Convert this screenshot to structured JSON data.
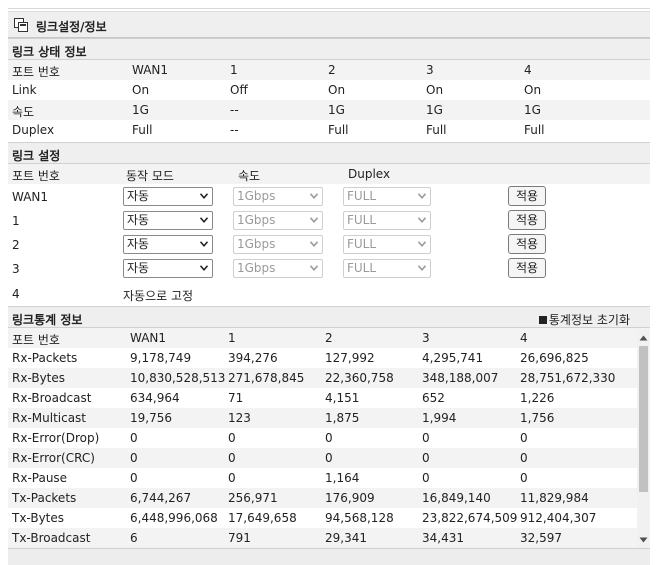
{
  "title": "링크설정/정보",
  "status": {
    "heading": "링크 상태 정보",
    "columns": [
      "포트 번호",
      "WAN1",
      "1",
      "2",
      "3",
      "4"
    ],
    "rows": [
      [
        "Link",
        "On",
        "Off",
        "On",
        "On",
        "On"
      ],
      [
        "속도",
        "1G",
        "--",
        "1G",
        "1G",
        "1G"
      ],
      [
        "Duplex",
        "Full",
        "--",
        "Full",
        "Full",
        "Full"
      ]
    ]
  },
  "config": {
    "heading": "링크 설정",
    "columns": [
      "포트 번호",
      "동작 모드",
      "속도",
      "Duplex"
    ],
    "rows": [
      {
        "port": "WAN1",
        "mode": "자동",
        "speed": "1Gbps",
        "duplex": "FULL",
        "apply": "적용"
      },
      {
        "port": "1",
        "mode": "자동",
        "speed": "1Gbps",
        "duplex": "FULL",
        "apply": "적용"
      },
      {
        "port": "2",
        "mode": "자동",
        "speed": "1Gbps",
        "duplex": "FULL",
        "apply": "적용"
      },
      {
        "port": "3",
        "mode": "자동",
        "speed": "1Gbps",
        "duplex": "FULL",
        "apply": "적용"
      }
    ],
    "fixed_port": "4",
    "fixed_text": "자동으로 고정"
  },
  "stats": {
    "heading": "링크통계 정보",
    "reset_label": "통계정보 초기화",
    "columns": [
      "포트 번호",
      "WAN1",
      "1",
      "2",
      "3",
      "4"
    ],
    "rows": [
      [
        "Rx-Packets",
        "9,178,749",
        "394,276",
        "127,992",
        "4,295,741",
        "26,696,825"
      ],
      [
        "Rx-Bytes",
        "10,830,528,513",
        "271,678,845",
        "22,360,758",
        "348,188,007",
        "28,751,672,330"
      ],
      [
        "Rx-Broadcast",
        "634,964",
        "71",
        "4,151",
        "652",
        "1,226"
      ],
      [
        "Rx-Multicast",
        "19,756",
        "123",
        "1,875",
        "1,994",
        "1,756"
      ],
      [
        "Rx-Error(Drop)",
        "0",
        "0",
        "0",
        "0",
        "0"
      ],
      [
        "Rx-Error(CRC)",
        "0",
        "0",
        "0",
        "0",
        "0"
      ],
      [
        "Rx-Pause",
        "0",
        "0",
        "1,164",
        "0",
        "0"
      ],
      [
        "Tx-Packets",
        "6,744,267",
        "256,971",
        "176,909",
        "16,849,140",
        "11,829,984"
      ],
      [
        "Tx-Bytes",
        "6,448,996,068",
        "17,649,658",
        "94,568,128",
        "23,822,674,509",
        "912,404,307"
      ],
      [
        "Tx-Broadcast",
        "6",
        "791",
        "29,341",
        "34,431",
        "32,597"
      ]
    ]
  }
}
